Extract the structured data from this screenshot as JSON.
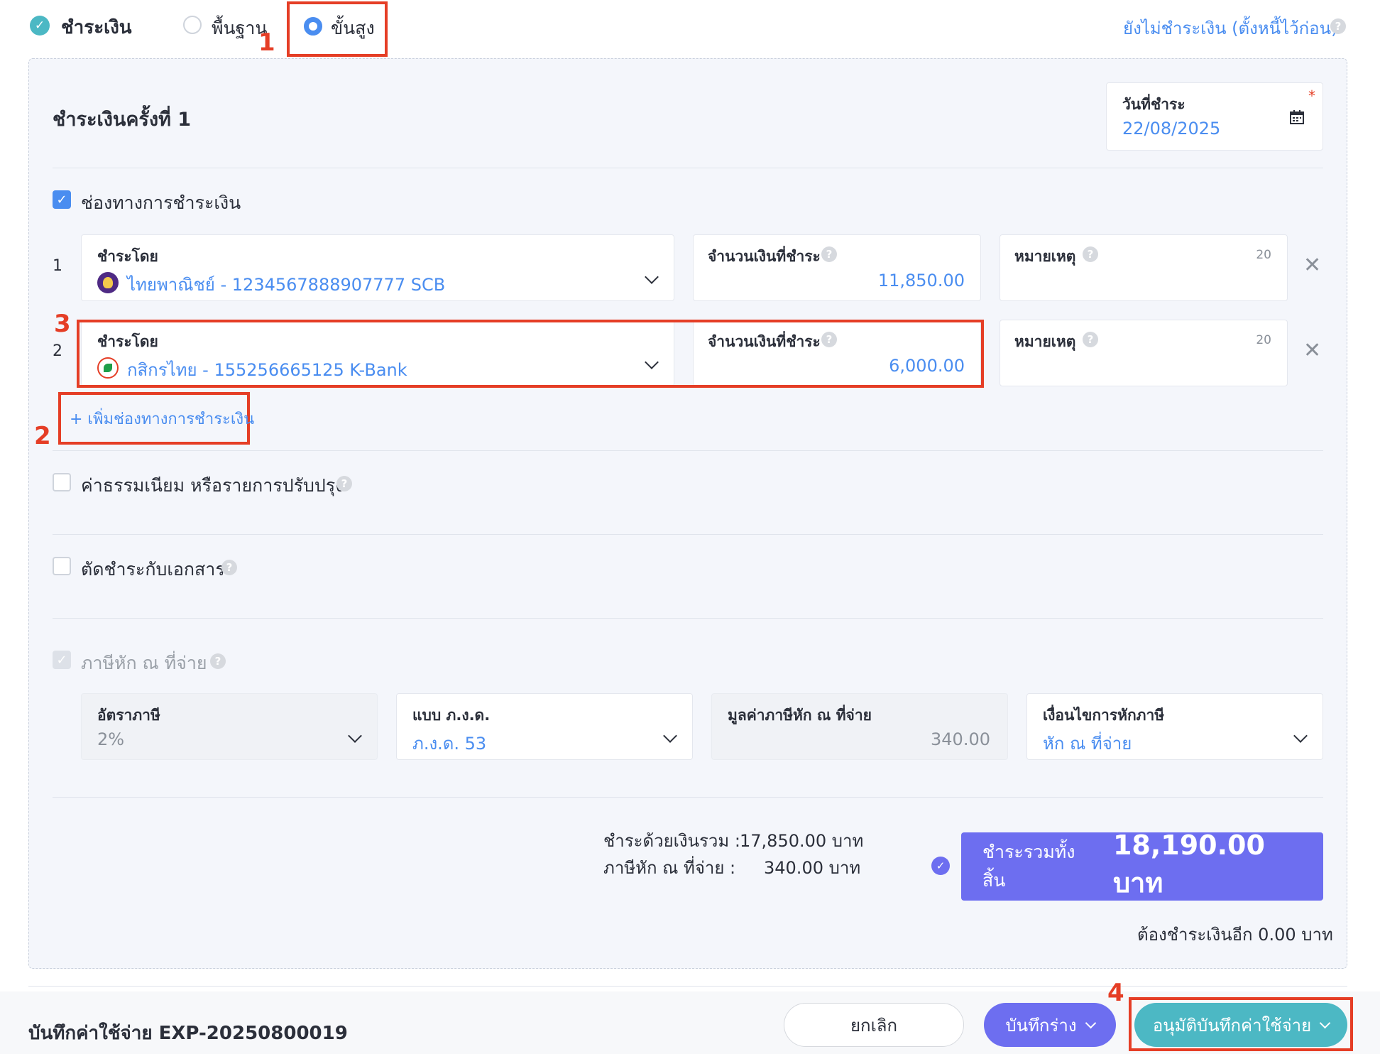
{
  "header": {
    "title": "ชำระเงิน",
    "mode_basic": "พื้นฐาน",
    "mode_advanced": "ขั้นสูง",
    "unpaid_link": "ยังไม่ชำระเงิน (ตั้งหนี้ไว้ก่อน)"
  },
  "annotations": [
    "1",
    "2",
    "3",
    "4"
  ],
  "payment": {
    "round_title": "ชำระเงินครั้งที่ 1",
    "date_label": "วันที่ชำระ",
    "date_required": "*",
    "date_value": "22/08/2025",
    "channels_label": "ช่องทางการชำระเงิน",
    "rows": [
      {
        "index": "1",
        "paid_by_label": "ชำระโดย",
        "bank": "ไทยพาณิชย์ - 1234567888907777 SCB",
        "amount_label": "จำนวนเงินที่ชำระ",
        "amount": "11,850.00",
        "note_label": "หมายเหตุ",
        "note_counter": "20"
      },
      {
        "index": "2",
        "paid_by_label": "ชำระโดย",
        "bank": "กสิกรไทย - 155256665125 K-Bank",
        "amount_label": "จำนวนเงินที่ชำระ",
        "amount": "6,000.00",
        "note_label": "หมายเหตุ",
        "note_counter": "20"
      }
    ],
    "add_channel": "+ เพิ่มช่องทางการชำระเงิน",
    "fee_label": "ค่าธรรมเนียม หรือรายการปรับปรุง",
    "offset_label": "ตัดชำระกับเอกสาร",
    "wht_label": "ภาษีหัก ณ ที่จ่าย",
    "wht_fields": {
      "rate_label": "อัตราภาษี",
      "rate_value": "2%",
      "form_label": "แบบ ภ.ง.ด.",
      "form_value": "ภ.ง.ด. 53",
      "amount_label": "มูลค่าภาษีหัก ณ ที่จ่าย",
      "amount_value": "340.00",
      "condition_label": "เงื่อนไขการหักภาษี",
      "condition_value": "หัก ณ ที่จ่าย"
    },
    "summary": {
      "paid_total_label": "ชำระด้วยเงินรวม :",
      "paid_total_value": "17,850.00 บาท",
      "wht_total_label": "ภาษีหัก ณ ที่จ่าย :",
      "wht_total_value": "340.00 บาท",
      "grand_label": "ชำระรวมทั้งสิ้น",
      "grand_value": "18,190.00 บาท",
      "remaining": "ต้องชำระเงินอีก 0.00 บาท"
    }
  },
  "footer": {
    "title": "บันทึกค่าใช้จ่าย EXP-20250800019",
    "cancel": "ยกเลิก",
    "draft": "บันทึกร่าง",
    "approve": "อนุมัติบันทึกค่าใช้จ่าย"
  },
  "colors": {
    "accent_blue": "#4a8df0",
    "teal": "#4cb8c4",
    "purple": "#6d6ef0",
    "annotation_red": "#e53e26"
  }
}
